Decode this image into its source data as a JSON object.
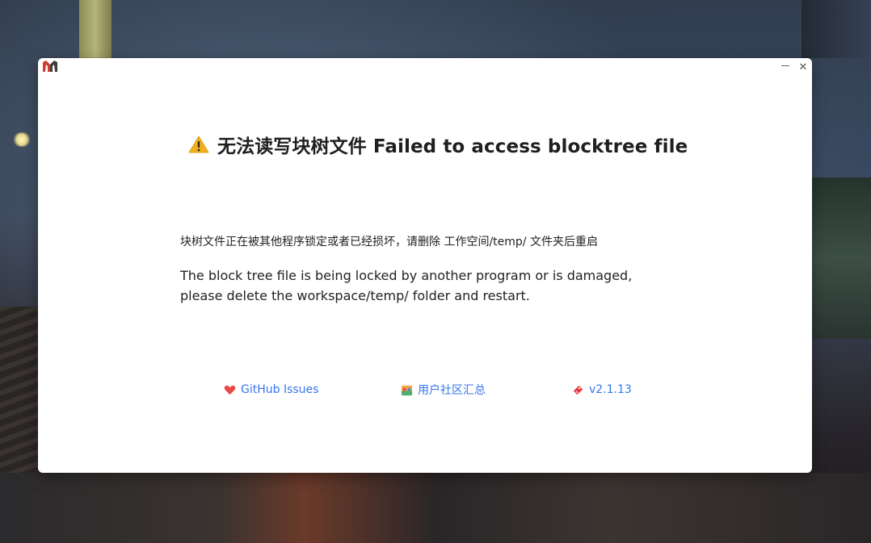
{
  "window": {
    "title_cn": "无法读写块树文件",
    "title_en": "Failed to access blocktree file",
    "title_full": "无法读写块树文件 Failed to access blocktree file",
    "message_cn": "块树文件正在被其他程序锁定或者已经损坏，请删除 工作空间/temp/ 文件夹后重启",
    "message_en": "The block tree file is being locked by another program or is damaged, please delete the workspace/temp/ folder and restart."
  },
  "links": {
    "github": {
      "label": "GitHub Issues",
      "icon": "heart-icon"
    },
    "community": {
      "label": "用户社区汇总",
      "icon": "community-icon"
    },
    "version": {
      "label": "v2.1.13",
      "icon": "ticket-icon"
    }
  },
  "colors": {
    "link": "#3575f0",
    "warning": "#f2b01e",
    "heart": "#e84a4a",
    "ticket": "#e8383e"
  }
}
